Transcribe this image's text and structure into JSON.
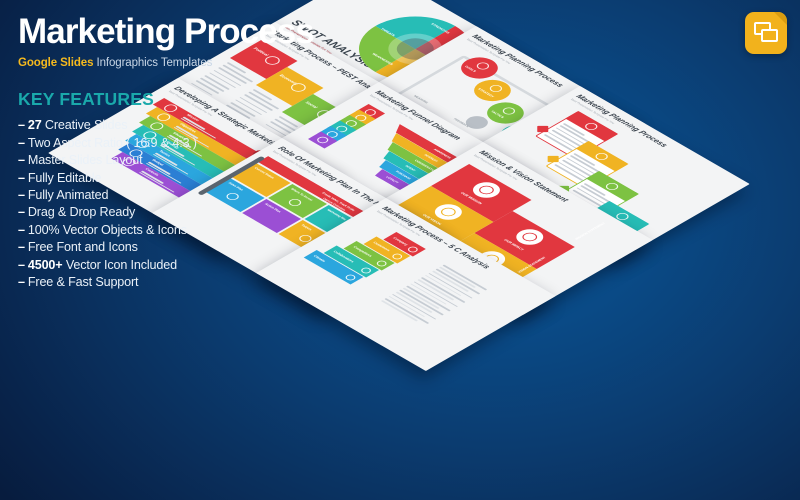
{
  "header": {
    "title": "Marketing Process",
    "subtitle_brand": "Google Slides",
    "subtitle_rest": " Infographics Templates",
    "badge_icon": "google-slides-icon"
  },
  "features": {
    "heading": "KEY FEATURES",
    "items": [
      {
        "dash": "–",
        "strong": "27",
        "text": " Creative Slides"
      },
      {
        "dash": "–",
        "strong": "",
        "text": "Two Aspect Ratio ( 16:9 & 4:3 )"
      },
      {
        "dash": "–",
        "strong": "",
        "text": "Master Slides Layout"
      },
      {
        "dash": "–",
        "strong": "",
        "text": "Fully Editable"
      },
      {
        "dash": "–",
        "strong": "",
        "text": "Fully Animated"
      },
      {
        "dash": "–",
        "strong": "",
        "text": "Drag & Drop Ready"
      },
      {
        "dash": "–",
        "strong": "",
        "text": "100% Vector Objects & Icons"
      },
      {
        "dash": "–",
        "strong": "",
        "text": "Free Font and Icons"
      },
      {
        "dash": "–",
        "strong": "4500+",
        "text": " Vector Icon Included"
      },
      {
        "dash": "–",
        "strong": "",
        "text": "Free & Fast Support"
      }
    ]
  },
  "colors": {
    "background_dark": "#0a2450",
    "background_light": "#0b5596",
    "accent_teal": "#1aa9ab",
    "accent_gold": "#f5b91e",
    "slide_red": "#e1373f",
    "slide_yellow": "#f0b323",
    "slide_green": "#7dc242",
    "slide_teal": "#27bdb6",
    "slide_blue": "#2ba6de",
    "slide_purple": "#9b4fd4",
    "slide_paper": "#f3f4f5"
  },
  "slides": [
    {
      "id": "swot-analysis",
      "title": "SWOT ANALYSIS",
      "subtitle": "Best Presentation Template For You",
      "type": "wheel-legend",
      "legend": [
        "Strengths",
        "Weaknesses",
        "Opportunities",
        "Threats"
      ],
      "legend_colors": [
        "#e1373f",
        "#f0b323",
        "#7dc242",
        "#27bdb6"
      ],
      "wheel_labels": [
        "STRENGTHS",
        "OPPORTUNITIES",
        "WEAKNESSES",
        "THREATS"
      ]
    },
    {
      "id": "marketing-planning-process-circles",
      "title": "Marketing Planning Process",
      "subtitle": "Best Presentation Template For You",
      "type": "circle-chain",
      "steps": [
        "GOALS",
        "STRATEGY",
        "TACTICS",
        "CONTROL",
        "RESULTS"
      ],
      "step_colors": [
        "#e1373f",
        "#f0b323",
        "#7dc242",
        "#27bdb6",
        "#2ba6de"
      ],
      "path_labels": [
        "MEASURE",
        "FEEDBACK",
        "IMPLEMENT"
      ]
    },
    {
      "id": "marketing-planning-process-cards",
      "title": "Marketing Planning Process",
      "subtitle": "Best Presentation Template For You",
      "type": "card-chain",
      "cards": [
        "Step 01",
        "Step 02",
        "Step 03",
        "Step 04"
      ],
      "card_colors": [
        "#e1373f",
        "#f0b323",
        "#7dc242",
        "#27bdb6"
      ]
    },
    {
      "id": "mission-vision-statement",
      "title": "Mission & Vision Statement",
      "subtitle": "Best Presentation Template For You",
      "type": "quad-blocks",
      "blocks": [
        "OUR MISSION",
        "OUR IMPACT",
        "OUR VISION",
        "OUR VALUES"
      ],
      "side_labels": [
        "MISSION STATEMENT",
        "VISION STATEMENT"
      ],
      "block_colors": [
        "#e1373f",
        "#e1373f",
        "#f0b323",
        "#f0b323"
      ]
    },
    {
      "id": "marketing-process-pest-analysis",
      "title": "Marketing Process – PEST Analysis",
      "subtitle": "Best Presentation Template For You",
      "type": "column-headers",
      "columns": [
        "Political",
        "Economic",
        "Social",
        "Technological"
      ],
      "column_colors": [
        "#e1373f",
        "#f0b323",
        "#7dc242",
        "#27bdb6"
      ]
    },
    {
      "id": "marketing-funnel-diagram",
      "title": "Marketing Funnel Diagram",
      "subtitle": "Best Presentation Template For You",
      "type": "funnel",
      "stages": [
        "AWARENESS",
        "INTEREST",
        "CONSIDERATION",
        "INTENT",
        "PURCHASE",
        "LOYALTY"
      ],
      "stage_colors": [
        "#e1373f",
        "#f0b323",
        "#7dc242",
        "#27bdb6",
        "#2ba6de",
        "#9b4fd4"
      ]
    },
    {
      "id": "marketing-process-5c-analysis",
      "title": "Marketing Process – 5 C Analysis",
      "subtitle": "Best Presentation Template For You",
      "type": "step-tiles-list",
      "tiles": [
        "Company",
        "Customers",
        "Competitors",
        "Collaborators",
        "Climate"
      ],
      "tile_colors": [
        "#e1373f",
        "#f0b323",
        "#7dc242",
        "#27bdb6",
        "#2ba6de"
      ]
    },
    {
      "id": "role-of-marketing-plan",
      "title": "Role Of Marketing Plan In The Marketing Process",
      "subtitle": "Best Presentation Template For You",
      "type": "grid-pyramid",
      "cells": [
        "Current Status",
        "Where To Invest",
        "Marketing Mix",
        "Sales Plan",
        "Action Plan",
        "Targets"
      ],
      "banner_labels": [
        "Create Value, Track Profit",
        "Capture Collection"
      ],
      "cell_colors": [
        "#f0b323",
        "#7dc242",
        "#27bdb6",
        "#2ba6de",
        "#9b4fd4",
        "#f0b323"
      ]
    },
    {
      "id": "developing-strategic-marketing-plan-steps",
      "title": "Developing A Strategic Marketing Plan Steps",
      "subtitle": "Best Presentation Template For You",
      "type": "rainbow-bars",
      "bars": [
        "Mission",
        "Objectives",
        "Situation",
        "Strategy",
        "Tactics",
        "Budget",
        "Controls"
      ],
      "bar_colors": [
        "#e1373f",
        "#f0b323",
        "#7dc242",
        "#27bdb6",
        "#2ba6de",
        "#2b7fd4",
        "#9b4fd4"
      ]
    }
  ]
}
